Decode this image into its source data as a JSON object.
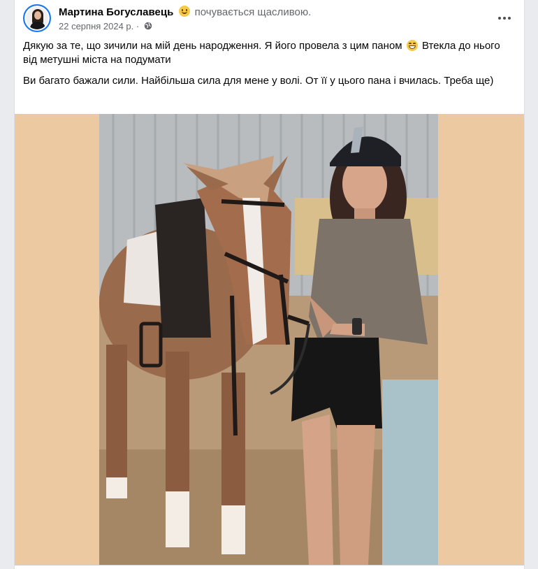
{
  "post": {
    "author": "Мартина Богуславець",
    "feeling": "почувається щасливою.",
    "feeling_icon": "smile-emoji-icon",
    "date": "22 серпня 2024 р.",
    "separator": "·",
    "privacy_icon": "globe-icon",
    "more_icon": "more-options-icon",
    "text_paragraph_1_part_1": "Дякую за те, що зичили на мій день народження. Я його провела з цим паном",
    "text_paragraph_1_emoji": "grinning-emoji-icon",
    "text_paragraph_1_part_2": "Втекла до нього від метушні міста на подумати",
    "text_paragraph_2": "Ви багато бажали сили. Найбільша сила для мене у волі. От її у цього пана і вчилась. Треба ще)",
    "photo": "photo of a woman in a riding helmet standing next to a brown and white horse",
    "colors": {
      "photo_frame": "#ecc9a1",
      "accent": "#1877f2",
      "secondary_text": "#65676b"
    }
  }
}
